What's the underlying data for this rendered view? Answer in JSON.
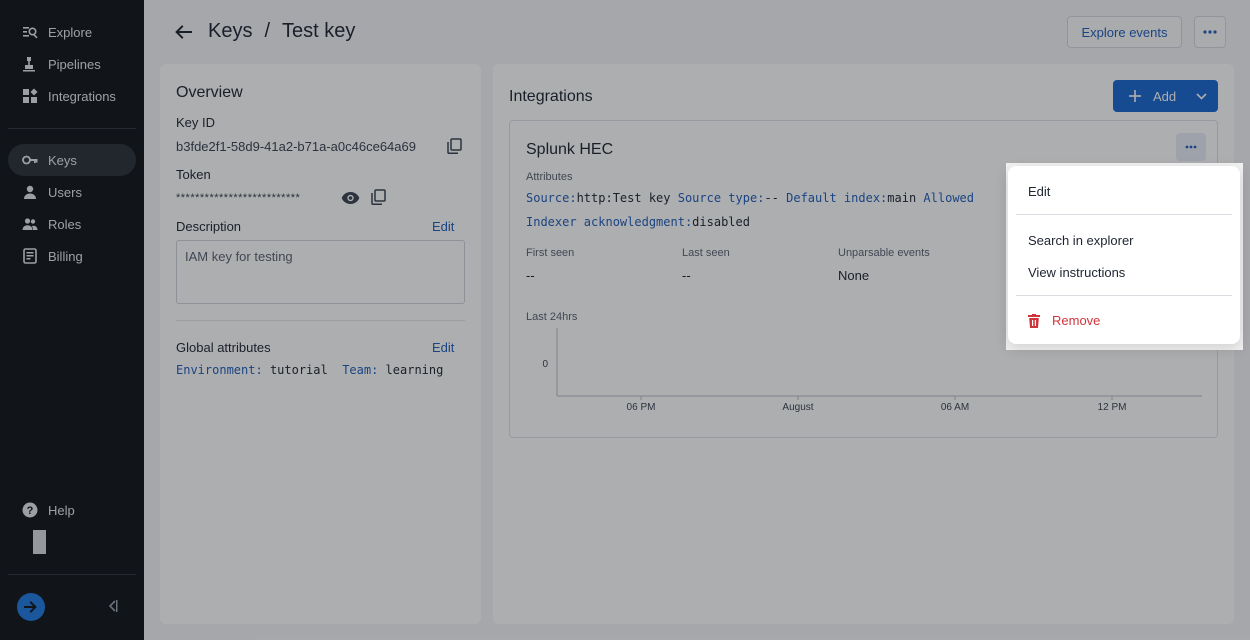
{
  "sidebar": {
    "items": [
      {
        "label": "Explore",
        "icon": "explore-icon"
      },
      {
        "label": "Pipelines",
        "icon": "pipelines-icon"
      },
      {
        "label": "Integrations",
        "icon": "integrations-icon"
      },
      {
        "label": "Keys",
        "icon": "key-icon"
      },
      {
        "label": "Users",
        "icon": "user-icon"
      },
      {
        "label": "Roles",
        "icon": "roles-icon"
      },
      {
        "label": "Billing",
        "icon": "billing-icon"
      }
    ],
    "help": "Help"
  },
  "header": {
    "crumb_parent": "Keys",
    "crumb_sep": "/",
    "crumb_current": "Test key",
    "explore_events": "Explore events"
  },
  "overview": {
    "title": "Overview",
    "key_id_label": "Key ID",
    "key_id_value": "b3fde2f1-58d9-41a2-b71a-a0c46ce64a69",
    "token_label": "Token",
    "token_value": "**************************",
    "description_label": "Description",
    "description_edit": "Edit",
    "description_value": "IAM key for testing",
    "global_label": "Global attributes",
    "global_edit": "Edit",
    "global_attrs": [
      {
        "key": "Environment:",
        "value": "tutorial"
      },
      {
        "key": "Team:",
        "value": "learning"
      }
    ]
  },
  "integrations": {
    "title": "Integrations",
    "add_label": "Add",
    "card": {
      "name": "Splunk HEC",
      "attributes_label": "Attributes",
      "attrs_line1": [
        {
          "key": "Source:",
          "value": "http:Test key"
        },
        {
          "key": "Source type:",
          "value": "--"
        },
        {
          "key": "Default index:",
          "value": "main"
        },
        {
          "key": "Allowed",
          "value": ""
        }
      ],
      "attrs_line2": [
        {
          "key": "Indexer acknowledgment:",
          "value": "disabled"
        }
      ],
      "stats": [
        {
          "label": "First seen",
          "value": "--"
        },
        {
          "label": "Last seen",
          "value": "--"
        },
        {
          "label": "Unparsable events",
          "value": "None"
        }
      ],
      "chart_caption": "Last 24hrs"
    }
  },
  "chart_data": {
    "type": "line",
    "title": "",
    "xlabel": "",
    "ylabel": "",
    "x_ticks": [
      "06 PM",
      "August",
      "06 AM",
      "12 PM"
    ],
    "y_ticks": [
      "0"
    ],
    "series": []
  },
  "menu": {
    "edit": "Edit",
    "search": "Search in explorer",
    "instructions": "View instructions",
    "remove": "Remove",
    "remove_color": "#d0343b"
  },
  "colors": {
    "accent": "#1868d0",
    "link": "#1f5db8",
    "sidebar_bg": "#101418"
  }
}
